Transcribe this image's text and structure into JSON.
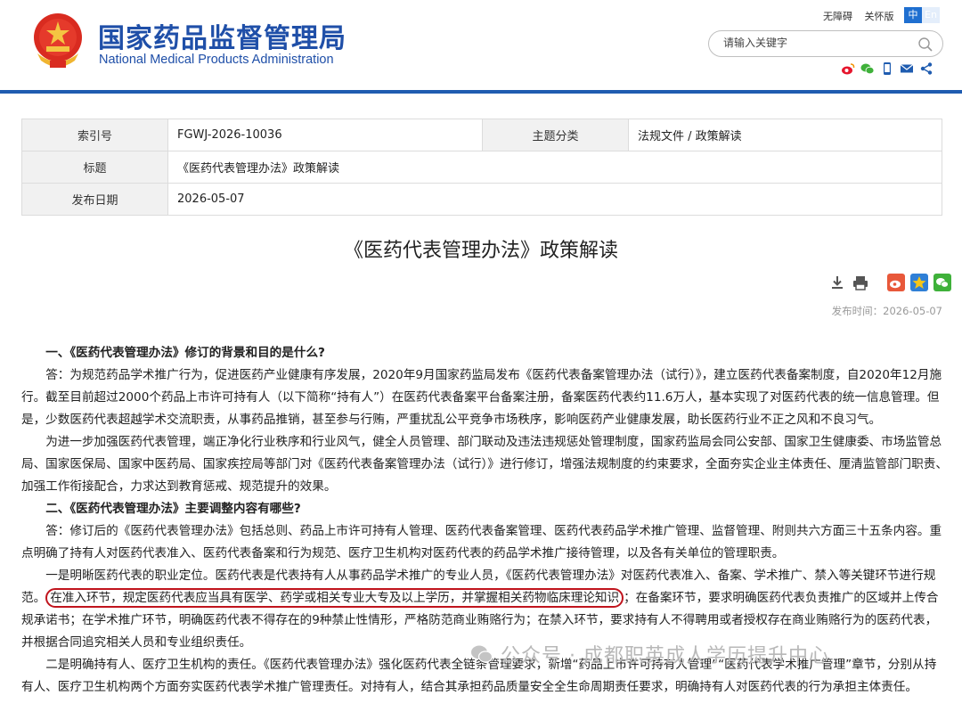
{
  "header": {
    "title_cn": "国家药品监督管理局",
    "title_en": "National Medical Products Administration",
    "links": [
      "无障碍",
      "关怀版"
    ],
    "lang": {
      "active": "中",
      "inactive": "En"
    },
    "search": {
      "placeholder": "请输入关键字"
    },
    "social_icons": [
      "weibo-icon",
      "wechat-icon",
      "mobile-icon",
      "mail-icon",
      "share-icon"
    ]
  },
  "meta": {
    "index_label": "索引号",
    "index_value": "FGWJ-2026-10036",
    "category_label": "主题分类",
    "category_value": "法规文件 / 政策解读",
    "title_label": "标题",
    "title_value": "《医药代表管理办法》政策解读",
    "date_label": "发布日期",
    "date_value": "2026-05-07"
  },
  "article": {
    "title": "《医药代表管理办法》政策解读",
    "pubtime": "发布时间：2026-05-07",
    "paragraphs": {
      "h1": "一、《医药代表管理办法》修订的背景和目的是什么?",
      "p1": "答：为规范药品学术推广行为，促进医药产业健康有序发展，2020年9月国家药监局发布《医药代表备案管理办法（试行）》，建立医药代表备案制度，自2020年12月施行。截至目前超过2000个药品上市许可持有人（以下简称“持有人”）在医药代表备案平台备案注册，备案医药代表约11.6万人，基本实现了对医药代表的统一信息管理。但是，少数医药代表超越学术交流职责，从事药品推销，甚至参与行贿，严重扰乱公平竞争市场秩序，影响医药产业健康发展，助长医药行业不正之风和不良习气。",
      "p2": "为进一步加强医药代表管理，端正净化行业秩序和行业风气，健全人员管理、部门联动及违法违规惩处管理制度，国家药监局会同公安部、国家卫生健康委、市场监管总局、国家医保局、国家中医药局、国家疾控局等部门对《医药代表备案管理办法（试行）》进行修订，增强法规制度的约束要求，全面夯实企业主体责任、厘清监管部门职责、加强工作衔接配合，力求达到教育惩戒、规范提升的效果。",
      "h2": "二、《医药代表管理办法》主要调整内容有哪些?",
      "p3": "答：修订后的《医药代表管理办法》包括总则、药品上市许可持有人管理、医药代表备案管理、医药代表药品学术推广管理、监督管理、附则共六方面三十五条内容。重点明确了持有人对医药代表准入、医药代表备案和行为规范、医疗卫生机构对医药代表的药品学术推广接待管理，以及各有关单位的管理职责。",
      "p4a": "一是明晰医药代表的职业定位。医药代表是代表持有人从事药品学术推广的专业人员，《医药代表管理办法》对医药代表准入、备案、学术推广、禁入等关键环节进行规范。",
      "p4b": "在准入环节，规定医药代表应当具有医学、药学或相关专业大专及以上学历，并掌握相关药物临床理论知识",
      "p4c": "；在备案环节，要求明确医药代表负责推广的区域并上传合规承诺书；在学术推广环节，明确医药代表不得存在的9种禁止性情形，严格防范商业贿赂行为；在禁入环节，要求持有人不得聘用或者授权存在商业贿赂行为的医药代表，并根据合同追究相关人员和专业组织责任。",
      "p5": "二是明确持有人、医疗卫生机构的责任。《医药代表管理办法》强化医药代表全链条管理要求，新增“药品上市许可持有人管理”“医药代表学术推广管理”章节，分别从持有人、医疗卫生机构两个方面夯实医药代表学术推广管理责任。对持有人，结合其承担药品质量安全全生命周期责任要求，明确持有人对医药代表的行为承担主体责任。"
    }
  },
  "watermark": {
    "text": "公众号 · 成都职英成人学历提升中心"
  },
  "colors": {
    "brand_blue": "#1f4fa8",
    "bar_blue": "#1f5cb0",
    "highlight_red": "#c0141d"
  }
}
